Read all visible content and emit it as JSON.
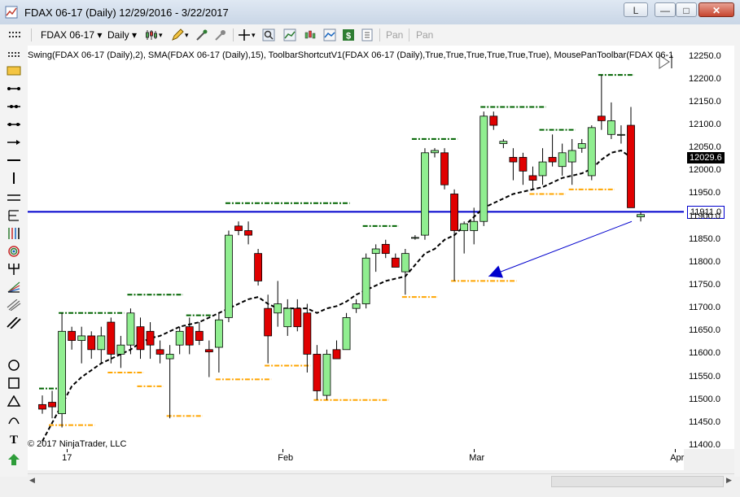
{
  "window": {
    "title": "FDAX 06-17 (Daily)  12/29/2016 - 3/22/2017",
    "btn_l": "L",
    "btn_min": "—",
    "btn_max": "□",
    "btn_close": "✕"
  },
  "toolbar": {
    "instrument": "FDAX 06-17",
    "interval": "Daily",
    "pan1": "Pan",
    "pan2": "Pan"
  },
  "chart": {
    "indicators_label": "Swing(FDAX 06-17 (Daily),2), SMA(FDAX 06-17 (Daily),15), ToolbarShortcutV1(FDAX 06-17 (Daily),True,True,True,True,True,True), MousePanToolbar(FDAX 06-1",
    "copyright": "© 2017 NinjaTrader, LLC",
    "colors": {
      "up": "#90ee90",
      "down": "#e00000",
      "sma": "#000000",
      "swing_high": "#006400",
      "swing_low": "#ffa500",
      "hline": "#0000cd",
      "arrow": "#0000cd"
    }
  },
  "chart_data": {
    "type": "candlestick",
    "y_ticks": [
      "12250.0",
      "12200.0",
      "12150.0",
      "12100.0",
      "12050.0",
      "12000.0",
      "11950.0",
      "11900.0",
      "11850.0",
      "11800.0",
      "11750.0",
      "11700.0",
      "11650.0",
      "11600.0",
      "11550.0",
      "11500.0",
      "11450.0",
      "11400.0"
    ],
    "ylim": [
      11400,
      12260
    ],
    "x_labels": [
      "17",
      "Feb",
      "Mar",
      "Apr"
    ],
    "last_price_label": "12029.6",
    "hline_label": "11911.0",
    "hline_value": 11911,
    "candles": [
      {
        "o": 11490,
        "h": 11510,
        "l": 11470,
        "c": 11480
      },
      {
        "o": 11495,
        "h": 11520,
        "l": 11460,
        "c": 11485
      },
      {
        "o": 11470,
        "h": 11690,
        "l": 11440,
        "c": 11650
      },
      {
        "o": 11650,
        "h": 11660,
        "l": 11610,
        "c": 11630
      },
      {
        "o": 11630,
        "h": 11660,
        "l": 11580,
        "c": 11640
      },
      {
        "o": 11640,
        "h": 11650,
        "l": 11590,
        "c": 11610
      },
      {
        "o": 11610,
        "h": 11660,
        "l": 11580,
        "c": 11640
      },
      {
        "o": 11670,
        "h": 11680,
        "l": 11580,
        "c": 11600
      },
      {
        "o": 11600,
        "h": 11640,
        "l": 11570,
        "c": 11620
      },
      {
        "o": 11620,
        "h": 11700,
        "l": 11600,
        "c": 11690
      },
      {
        "o": 11660,
        "h": 11680,
        "l": 11590,
        "c": 11610
      },
      {
        "o": 11650,
        "h": 11670,
        "l": 11590,
        "c": 11620
      },
      {
        "o": 11610,
        "h": 11630,
        "l": 11580,
        "c": 11600
      },
      {
        "o": 11590,
        "h": 11620,
        "l": 11460,
        "c": 11600
      },
      {
        "o": 11620,
        "h": 11660,
        "l": 11600,
        "c": 11650
      },
      {
        "o": 11660,
        "h": 11680,
        "l": 11600,
        "c": 11620
      },
      {
        "o": 11650,
        "h": 11670,
        "l": 11620,
        "c": 11630
      },
      {
        "o": 11610,
        "h": 11630,
        "l": 11550,
        "c": 11605
      },
      {
        "o": 11615,
        "h": 11690,
        "l": 11560,
        "c": 11675
      },
      {
        "o": 11680,
        "h": 11870,
        "l": 11670,
        "c": 11860
      },
      {
        "o": 11880,
        "h": 11890,
        "l": 11860,
        "c": 11870
      },
      {
        "o": 11870,
        "h": 11890,
        "l": 11840,
        "c": 11860
      },
      {
        "o": 11820,
        "h": 11830,
        "l": 11750,
        "c": 11760
      },
      {
        "o": 11700,
        "h": 11730,
        "l": 11580,
        "c": 11640
      },
      {
        "o": 11690,
        "h": 11760,
        "l": 11660,
        "c": 11710
      },
      {
        "o": 11660,
        "h": 11720,
        "l": 11640,
        "c": 11700
      },
      {
        "o": 11700,
        "h": 11720,
        "l": 11650,
        "c": 11660
      },
      {
        "o": 11690,
        "h": 11710,
        "l": 11560,
        "c": 11600
      },
      {
        "o": 11600,
        "h": 11620,
        "l": 11500,
        "c": 11520
      },
      {
        "o": 11510,
        "h": 11610,
        "l": 11500,
        "c": 11600
      },
      {
        "o": 11610,
        "h": 11630,
        "l": 11590,
        "c": 11590
      },
      {
        "o": 11610,
        "h": 11690,
        "l": 11610,
        "c": 11680
      },
      {
        "o": 11700,
        "h": 11720,
        "l": 11690,
        "c": 11710
      },
      {
        "o": 11710,
        "h": 11820,
        "l": 11700,
        "c": 11810
      },
      {
        "o": 11820,
        "h": 11840,
        "l": 11780,
        "c": 11830
      },
      {
        "o": 11840,
        "h": 11850,
        "l": 11810,
        "c": 11820
      },
      {
        "o": 11810,
        "h": 11820,
        "l": 11790,
        "c": 11790
      },
      {
        "o": 11780,
        "h": 11830,
        "l": 11730,
        "c": 11820
      },
      {
        "o": 11855,
        "h": 11860,
        "l": 11850,
        "c": 11855
      },
      {
        "o": 11860,
        "h": 12050,
        "l": 11850,
        "c": 12040
      },
      {
        "o": 12040,
        "h": 12050,
        "l": 12030,
        "c": 12045
      },
      {
        "o": 12040,
        "h": 12050,
        "l": 11960,
        "c": 11970
      },
      {
        "o": 11950,
        "h": 11960,
        "l": 11760,
        "c": 11870
      },
      {
        "o": 11870,
        "h": 11890,
        "l": 11820,
        "c": 11885
      },
      {
        "o": 11870,
        "h": 11920,
        "l": 11840,
        "c": 11890
      },
      {
        "o": 11890,
        "h": 12130,
        "l": 11880,
        "c": 12120
      },
      {
        "o": 12120,
        "h": 12130,
        "l": 12090,
        "c": 12100
      },
      {
        "o": 12060,
        "h": 12070,
        "l": 12050,
        "c": 12065
      },
      {
        "o": 12030,
        "h": 12050,
        "l": 11980,
        "c": 12020
      },
      {
        "o": 12030,
        "h": 12040,
        "l": 11970,
        "c": 12000
      },
      {
        "o": 11990,
        "h": 12010,
        "l": 11960,
        "c": 11980
      },
      {
        "o": 11990,
        "h": 12050,
        "l": 11970,
        "c": 12020
      },
      {
        "o": 12030,
        "h": 12080,
        "l": 12010,
        "c": 12020
      },
      {
        "o": 12010,
        "h": 12060,
        "l": 11990,
        "c": 12040
      },
      {
        "o": 12020,
        "h": 12070,
        "l": 11970,
        "c": 12045
      },
      {
        "o": 12050,
        "h": 12070,
        "l": 12040,
        "c": 12060
      },
      {
        "o": 11990,
        "h": 12100,
        "l": 11980,
        "c": 12095
      },
      {
        "o": 12120,
        "h": 12210,
        "l": 12090,
        "c": 12110
      },
      {
        "o": 12080,
        "h": 12150,
        "l": 12070,
        "c": 12110
      },
      {
        "o": 12080,
        "h": 12100,
        "l": 12060,
        "c": 12080
      },
      {
        "o": 12100,
        "h": 12140,
        "l": 11930,
        "c": 11920
      },
      {
        "o": 11900,
        "h": 11910,
        "l": 11890,
        "c": 11905
      }
    ],
    "sma": [
      11410,
      11450,
      11490,
      11530,
      11550,
      11565,
      11580,
      11590,
      11600,
      11610,
      11625,
      11635,
      11640,
      11650,
      11660,
      11665,
      11670,
      11680,
      11690,
      11700,
      11710,
      11720,
      11725,
      11710,
      11700,
      11700,
      11700,
      11700,
      11690,
      11700,
      11705,
      11715,
      11730,
      11740,
      11750,
      11760,
      11765,
      11770,
      11795,
      11820,
      11830,
      11850,
      11860,
      11880,
      11900,
      11920,
      11930,
      11940,
      11950,
      11955,
      11960,
      11965,
      11975,
      11985,
      11990,
      11995,
      12005,
      12025,
      12040,
      12045,
      12030
    ],
    "swing_highs": [
      {
        "v": 11525,
        "i0": 0,
        "i1": 2
      },
      {
        "v": 11690,
        "i0": 2,
        "i1": 8
      },
      {
        "v": 11730,
        "i0": 9,
        "i1": 14
      },
      {
        "v": 11685,
        "i0": 15,
        "i1": 17
      },
      {
        "v": 11930,
        "i0": 19,
        "i1": 31
      },
      {
        "v": 11880,
        "i0": 33,
        "i1": 36
      },
      {
        "v": 12070,
        "i0": 38,
        "i1": 42
      },
      {
        "v": 12140,
        "i0": 45,
        "i1": 51
      },
      {
        "v": 12090,
        "i0": 51,
        "i1": 54
      },
      {
        "v": 12210,
        "i0": 57,
        "i1": 60
      }
    ],
    "swing_lows": [
      {
        "v": 11445,
        "i0": 1,
        "i1": 5
      },
      {
        "v": 11560,
        "i0": 7,
        "i1": 10
      },
      {
        "v": 11530,
        "i0": 10,
        "i1": 12
      },
      {
        "v": 11465,
        "i0": 13,
        "i1": 16
      },
      {
        "v": 11545,
        "i0": 18,
        "i1": 23
      },
      {
        "v": 11575,
        "i0": 23,
        "i1": 27
      },
      {
        "v": 11500,
        "i0": 28,
        "i1": 35
      },
      {
        "v": 11725,
        "i0": 37,
        "i1": 40
      },
      {
        "v": 11760,
        "i0": 42,
        "i1": 48
      },
      {
        "v": 11950,
        "i0": 50,
        "i1": 53
      },
      {
        "v": 11960,
        "i0": 54,
        "i1": 58
      }
    ]
  }
}
